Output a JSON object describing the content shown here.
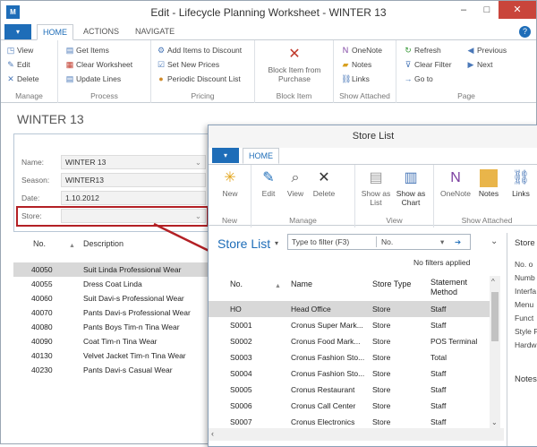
{
  "window": {
    "title": "Edit - Lifecycle Planning Worksheet - WINTER 13",
    "app_icon": "M",
    "minimize": "‒",
    "maximize": "□",
    "close": "✕"
  },
  "tabs": {
    "file": "▾",
    "home": "HOME",
    "actions": "ACTIONS",
    "navigate": "NAVIGATE",
    "help": "?"
  },
  "ribbon": {
    "manage": {
      "label": "Manage",
      "view": "View",
      "edit": "Edit",
      "delete": "Delete"
    },
    "process": {
      "label": "Process",
      "get_items": "Get Items",
      "clear_worksheet": "Clear Worksheet",
      "update_lines": "Update Lines"
    },
    "pricing": {
      "label": "Pricing",
      "add_items": "Add Items to Discount",
      "set_new_prices": "Set New Prices",
      "periodic": "Periodic Discount List"
    },
    "block_item": {
      "label": "Block Item",
      "button": "Block Item from Purchase"
    },
    "show_attached": {
      "label": "Show Attached",
      "onenote": "OneNote",
      "notes": "Notes",
      "links": "Links"
    },
    "page": {
      "label": "Page",
      "refresh": "Refresh",
      "clear_filter": "Clear Filter",
      "goto": "Go to",
      "previous": "Previous",
      "next": "Next"
    }
  },
  "card": {
    "title": "WINTER 13",
    "fields": [
      {
        "label": "Name:",
        "value": "WINTER 13"
      },
      {
        "label": "Season:",
        "value": "WINTER13"
      },
      {
        "label": "Date:",
        "value": "1.10.2012"
      },
      {
        "label": "Store:",
        "value": ""
      }
    ]
  },
  "lines": {
    "col_no": "No.",
    "col_desc": "Description",
    "rows": [
      {
        "no": "40050",
        "desc": "Suit Linda Professional Wear"
      },
      {
        "no": "40055",
        "desc": "Dress Coat Linda"
      },
      {
        "no": "40060",
        "desc": "Suit Davi-s Professional Wear"
      },
      {
        "no": "40070",
        "desc": "Pants Davi-s Professional Wear"
      },
      {
        "no": "40080",
        "desc": "Pants Boys Tim-n Tina Wear"
      },
      {
        "no": "40090",
        "desc": "Coat Tim-n Tina Wear"
      },
      {
        "no": "40130",
        "desc": "Velvet Jacket Tim-n Tina Wear"
      },
      {
        "no": "40230",
        "desc": "Pants Davi-s Casual Wear"
      }
    ]
  },
  "store_list": {
    "title": "Store List",
    "tab_home": "HOME",
    "ribbon": {
      "new": "New",
      "edit": "Edit",
      "view": "View",
      "delete": "Delete",
      "show_as_list": "Show as List",
      "show_as_chart": "Show as Chart",
      "onenote": "OneNote",
      "notes": "Notes",
      "links": "Links",
      "g_new": "New",
      "g_manage": "Manage",
      "g_view": "View",
      "g_show_attached": "Show Attached"
    },
    "heading": "Store List",
    "filter_placeholder": "Type to filter (F3)",
    "filter_field": "No.",
    "no_filters": "No filters applied",
    "cols": {
      "no": "No.",
      "name": "Name",
      "store_type": "Store Type",
      "method": "Statement Method"
    },
    "rows": [
      {
        "no": "HO",
        "name": "Head Office",
        "type": "Store",
        "method": "Staff"
      },
      {
        "no": "S0001",
        "name": "Cronus Super Mark...",
        "type": "Store",
        "method": "Staff"
      },
      {
        "no": "S0002",
        "name": "Cronus Food Mark...",
        "type": "Store",
        "method": "POS Terminal"
      },
      {
        "no": "S0003",
        "name": "Cronus Fashion Sto...",
        "type": "Store",
        "method": "Total"
      },
      {
        "no": "S0004",
        "name": "Cronus Fashion Sto...",
        "type": "Store",
        "method": "Staff"
      },
      {
        "no": "S0005",
        "name": "Cronus Restaurant",
        "type": "Store",
        "method": "Staff"
      },
      {
        "no": "S0006",
        "name": "Cronus Call Center",
        "type": "Store",
        "method": "Staff"
      },
      {
        "no": "S0007",
        "name": "Cronus Electronics",
        "type": "Store",
        "method": "Staff"
      }
    ],
    "factbox": {
      "store_title": "Store",
      "items": [
        "No. o",
        "Numb",
        "Interfa",
        "Menu",
        "Funct",
        "Style P",
        "Hardw"
      ],
      "notes_title": "Notes"
    }
  }
}
